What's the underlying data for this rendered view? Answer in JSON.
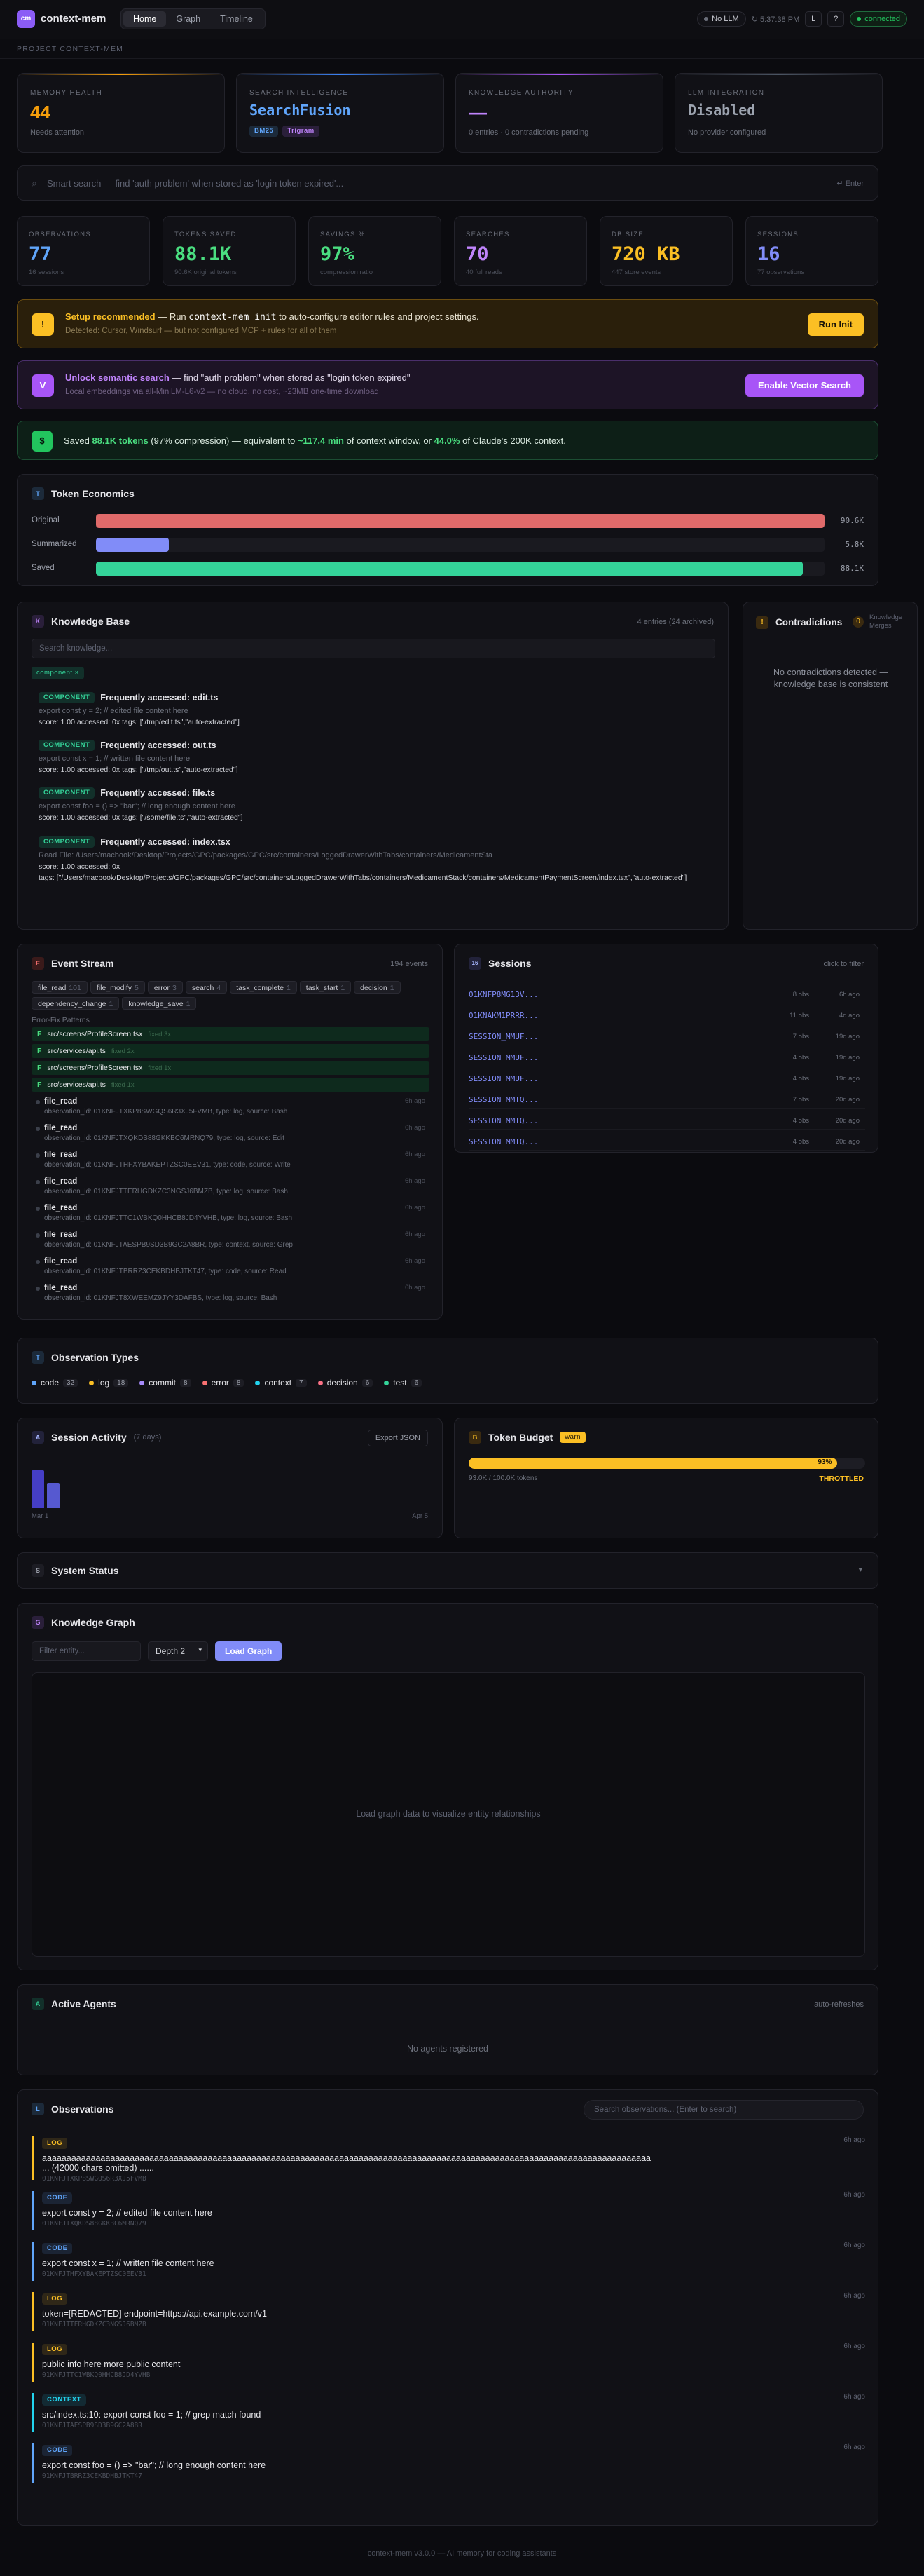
{
  "header": {
    "logo": "cm",
    "title": "context-mem",
    "tabs": [
      "Home",
      "Graph",
      "Timeline"
    ],
    "llm_pill": "No LLM",
    "clock": "5:37:38 PM",
    "btn_l": "L",
    "btn_q": "?",
    "status": "connected"
  },
  "project_bar": "PROJECT CONTEXT-MEM",
  "health": [
    {
      "label": "MEMORY HEALTH",
      "value": "44",
      "sub": "Needs attention",
      "color": "#f59e0b",
      "bar": "#f59e0b"
    },
    {
      "label": "SEARCH INTELLIGENCE",
      "value": "SearchFusion",
      "badges": [
        "BM25",
        "Trigram"
      ],
      "color": "#60a5fa",
      "bar": "#3b82f6"
    },
    {
      "label": "KNOWLEDGE AUTHORITY",
      "value": "—",
      "sub": "0 entries · 0 contradictions pending",
      "color": "#c084fc",
      "bar": "#a855f7"
    },
    {
      "label": "LLM INTEGRATION",
      "value": "Disabled",
      "sub": "No provider configured",
      "color": "#9ca3af",
      "bar": "#4b5563"
    }
  ],
  "search": {
    "placeholder": "Smart search — find 'auth problem' when stored as 'login token expired'...",
    "hint": "↵ Enter"
  },
  "stats": [
    {
      "label": "OBSERVATIONS",
      "value": "77",
      "sub": "16 sessions",
      "color": "#60a5fa"
    },
    {
      "label": "TOKENS SAVED",
      "value": "88.1K",
      "sub": "90.6K original tokens",
      "color": "#4ade80"
    },
    {
      "label": "SAVINGS %",
      "value": "97%",
      "sub": "compression ratio",
      "color": "#4ade80"
    },
    {
      "label": "SEARCHES",
      "value": "70",
      "sub": "40 full reads",
      "color": "#c084fc"
    },
    {
      "label": "DB SIZE",
      "value": "720 KB",
      "sub": "447 store events",
      "color": "#fbbf24"
    },
    {
      "label": "SESSIONS",
      "value": "16",
      "sub": "77 observations",
      "color": "#818cf8"
    }
  ],
  "setup": {
    "icon": "!",
    "title": "Setup recommended",
    "text_a": " — Run ",
    "cmd": "context-mem init",
    "text_b": " to auto-configure editor rules and project settings.",
    "sub": "Detected: Cursor, Windsurf — but not configured MCP + rules for all of them",
    "button": "Run Init"
  },
  "semantic": {
    "icon": "V",
    "title": "Unlock semantic search",
    "text": " — find \"auth problem\" when stored as \"login token expired\"",
    "sub": "Local embeddings via all-MiniLM-L6-v2 — no cloud, no cost, ~23MB one-time download",
    "button": "Enable Vector Search"
  },
  "saved": {
    "icon": "$",
    "p1": "Saved ",
    "tokens": "88.1K tokens",
    "p2": " (97% compression) — equivalent to ",
    "mins": "~117.4 min",
    "p3": " of context window, or ",
    "pct": "44.0%",
    "p4": " of Claude's 200K context."
  },
  "token_economics": {
    "icon": "T",
    "title": "Token Economics",
    "rows": [
      {
        "label": "Original",
        "value": "90.6K",
        "fill": 1.0,
        "color": "#e06a6a"
      },
      {
        "label": "Summarized",
        "value": "5.8K",
        "fill": 0.1,
        "color": "#818cf8"
      },
      {
        "label": "Saved",
        "value": "88.1K",
        "fill": 0.97,
        "color": "#34d399"
      }
    ]
  },
  "knowledge": {
    "icon": "K",
    "title": "Knowledge Base",
    "meta": "4 entries (24 archived)",
    "search_placeholder": "Search knowledge...",
    "filter": "component ×",
    "entries": [
      {
        "tag": "COMPONENT",
        "title": "Frequently accessed: edit.ts",
        "body": "export const y = 2; // edited file content here",
        "meta": "score: 1.00   accessed: 0x   tags: [\"/tmp/edit.ts\",\"auto-extracted\"]"
      },
      {
        "tag": "COMPONENT",
        "title": "Frequently accessed: out.ts",
        "body": "export const x = 1; // written file content here",
        "meta": "score: 1.00   accessed: 0x   tags: [\"/tmp/out.ts\",\"auto-extracted\"]"
      },
      {
        "tag": "COMPONENT",
        "title": "Frequently accessed: file.ts",
        "body": "export const foo = () => \"bar\"; // long enough content here",
        "meta": "score: 1.00   accessed: 0x   tags: [\"/some/file.ts\",\"auto-extracted\"]"
      },
      {
        "tag": "COMPONENT",
        "title": "Frequently accessed: index.tsx",
        "body": "Read File: /Users/macbook/Desktop/Projects/GPC/packages/GPC/src/containers/LoggedDrawerWithTabs/containers/MedicamentSta",
        "meta": "score: 1.00   accessed: 0x",
        "tags2": "tags: [\"/Users/macbook/Desktop/Projects/GPC/packages/GPC/src/containers/LoggedDrawerWithTabs/containers/MedicamentStack/containers/MedicamentPaymentScreen/index.tsx\",\"auto-extracted\"]"
      }
    ]
  },
  "contradictions": {
    "icon": "!",
    "title": "Contradictions",
    "count": "0",
    "sub": "Knowledge Merges",
    "empty": "No contradictions detected — knowledge base is consistent"
  },
  "events": {
    "icon": "E",
    "title": "Event Stream",
    "meta": "194 events",
    "filters": [
      {
        "n": "file_read",
        "c": "101"
      },
      {
        "n": "file_modify",
        "c": "5"
      },
      {
        "n": "error",
        "c": "3"
      },
      {
        "n": "search",
        "c": "4"
      },
      {
        "n": "task_complete",
        "c": "1"
      },
      {
        "n": "task_start",
        "c": "1"
      },
      {
        "n": "decision",
        "c": "1"
      },
      {
        "n": "dependency_change",
        "c": "1"
      },
      {
        "n": "knowledge_save",
        "c": "1"
      }
    ],
    "error_label": "Error-Fix Patterns",
    "patterns": [
      {
        "f": "src/screens/ProfileScreen.tsx",
        "t": "fixed 3x"
      },
      {
        "f": "src/services/api.ts",
        "t": "fixed 2x"
      },
      {
        "f": "src/screens/ProfileScreen.tsx",
        "t": "fixed 1x"
      },
      {
        "f": "src/services/api.ts",
        "t": "fixed 1x"
      }
    ],
    "items": [
      {
        "t": "file_read",
        "d": "observation_id: 01KNFJTXKP8SWGQS6R3XJ5FVMB, type: log, source: Bash",
        "a": "6h ago"
      },
      {
        "t": "file_read",
        "d": "observation_id: 01KNFJTXQKDS88GKKBC6MRNQ79, type: log, source: Edit",
        "a": "6h ago"
      },
      {
        "t": "file_read",
        "d": "observation_id: 01KNFJTHFXYBAKEPTZSC0EEV31, type: code, source: Write",
        "a": "6h ago"
      },
      {
        "t": "file_read",
        "d": "observation_id: 01KNFJTTERHGDKZC3NGSJ6BMZB, type: log, source: Bash",
        "a": "6h ago"
      },
      {
        "t": "file_read",
        "d": "observation_id: 01KNFJTTC1WBKQ0HHCB8JD4YVHB, type: log, source: Bash",
        "a": "6h ago"
      },
      {
        "t": "file_read",
        "d": "observation_id: 01KNFJTAESPB9SD3B9GC2A8BR, type: context, source: Grep",
        "a": "6h ago"
      },
      {
        "t": "file_read",
        "d": "observation_id: 01KNFJTBRRZ3CEKBDHBJTKT47, type: code, source: Read",
        "a": "6h ago"
      },
      {
        "t": "file_read",
        "d": "observation_id: 01KNFJT8XWEEMZ9JYY3DAFBS, type: log, source: Bash",
        "a": "6h ago"
      }
    ]
  },
  "sessions": {
    "icon": "16",
    "title": "Sessions",
    "meta": "click to filter",
    "rows": [
      {
        "id": "01KNFP8MG13V...",
        "obs": "8 obs",
        "age": "6h ago"
      },
      {
        "id": "01KNAKM1PRRR...",
        "obs": "11 obs",
        "age": "4d ago"
      },
      {
        "id": "SESSION_MMUF...",
        "obs": "7 obs",
        "age": "19d ago"
      },
      {
        "id": "SESSION_MMUF...",
        "obs": "4 obs",
        "age": "19d ago"
      },
      {
        "id": "SESSION_MMUF...",
        "obs": "4 obs",
        "age": "19d ago"
      },
      {
        "id": "SESSION_MMTQ...",
        "obs": "7 obs",
        "age": "20d ago"
      },
      {
        "id": "SESSION_MMTQ...",
        "obs": "4 obs",
        "age": "20d ago"
      },
      {
        "id": "SESSION_MMTQ...",
        "obs": "4 obs",
        "age": "20d ago"
      }
    ]
  },
  "obs_types": {
    "icon": "T",
    "title": "Observation Types",
    "items": [
      {
        "n": "code",
        "c": "32",
        "color": "#60a5fa"
      },
      {
        "n": "log",
        "c": "18",
        "color": "#fbbf24"
      },
      {
        "n": "commit",
        "c": "8",
        "color": "#a78bfa"
      },
      {
        "n": "error",
        "c": "8",
        "color": "#f87171"
      },
      {
        "n": "context",
        "c": "7",
        "color": "#22d3ee"
      },
      {
        "n": "decision",
        "c": "6",
        "color": "#fb7185"
      },
      {
        "n": "test",
        "c": "6",
        "color": "#34d399"
      }
    ]
  },
  "activity": {
    "icon": "A",
    "title": "Session Activity",
    "range": "(7 days)",
    "export": "Export JSON",
    "bars": [
      0.9,
      0.6
    ],
    "x_start": "Mar 1",
    "x_end": "Apr 5"
  },
  "budget": {
    "icon": "B",
    "title": "Token Budget",
    "badge": "warn",
    "fill": 0.93,
    "pct": "93%",
    "used": "93.0K / 100.0K tokens",
    "state": "THROTTLED"
  },
  "system": {
    "icon": "S",
    "title": "System Status",
    "chev": "▾"
  },
  "graph": {
    "icon": "G",
    "title": "Knowledge Graph",
    "filter_placeholder": "Filter entity...",
    "depth": "Depth 2",
    "button": "Load Graph",
    "empty": "Load graph data to visualize entity relationships"
  },
  "agents": {
    "icon": "A",
    "title": "Active Agents",
    "meta": "auto-refreshes",
    "empty": "No agents registered"
  },
  "observations": {
    "icon": "L",
    "title": "Observations",
    "search_placeholder": "Search observations... (Enter to search)",
    "items": [
      {
        "tag": "LOG",
        "color": "#fbbf24",
        "text": "aaaaaaaaaaaaaaaaaaaaaaaaaaaaaaaaaaaaaaaaaaaaaaaaaaaaaaaaaaaaaaaaaaaaaaaaaaaaaaaaaaaaaaaaaaaaaaaaaaaaaaaaaaaaaaaaaaaaaaaaaaaaa",
        "text2": "... (42000 chars omitted) ......",
        "id": "01KNFJTXKP8SWGQS6R3XJ5FVMB",
        "age": "6h ago"
      },
      {
        "tag": "CODE",
        "color": "#60a5fa",
        "text": "export const y = 2; // edited file content here",
        "id": "01KNFJTXQKDS88GKKBC6MRNQ79",
        "age": "6h ago"
      },
      {
        "tag": "CODE",
        "color": "#60a5fa",
        "text": "export const x = 1; // written file content here",
        "id": "01KNFJTHFXYBAKEPTZSC0EEV31",
        "age": "6h ago"
      },
      {
        "tag": "LOG",
        "color": "#fbbf24",
        "text": "token=[REDACTED] endpoint=https://api.example.com/v1",
        "id": "01KNFJTTERHGDKZC3NGSJ6BMZB",
        "age": "6h ago"
      },
      {
        "tag": "LOG",
        "color": "#fbbf24",
        "text": "public info here more public content",
        "id": "01KNFJTTC1WBKQ0HHCB8JD4YVHB",
        "age": "6h ago"
      },
      {
        "tag": "CONTEXT",
        "color": "#22d3ee",
        "text": "src/index.ts:10: export const foo = 1; // grep match found",
        "id": "01KNFJTAESPB9SD3B9GC2A8BR",
        "age": "6h ago"
      },
      {
        "tag": "CODE",
        "color": "#60a5fa",
        "text": "export const foo = () => \"bar\"; // long enough content here",
        "id": "01KNFJTBRRZ3CEKBDHBJTKT47",
        "age": "6h ago"
      }
    ]
  },
  "footer": "context-mem v3.0.0 — AI memory for coding assistants"
}
